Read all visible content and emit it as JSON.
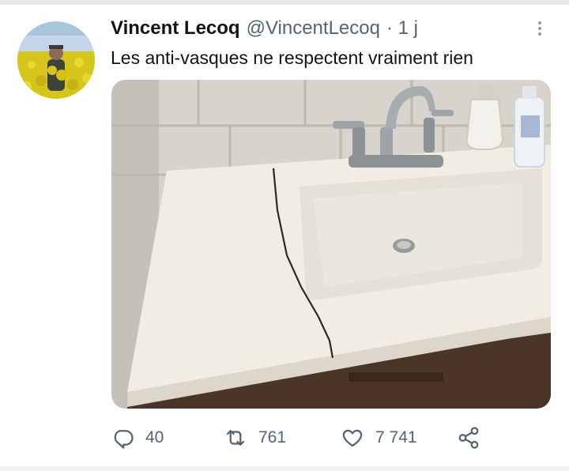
{
  "tweet": {
    "author_name": "Vincent Lecoq",
    "author_handle": "@VincentLecoq",
    "timestamp": "· 1 j",
    "text": "Les anti-vasques ne respectent vraiment rien",
    "more_icon": "more-vertical-icon",
    "avatar_alt": "avatar"
  },
  "actions": {
    "reply": {
      "icon": "reply-icon",
      "count": "40"
    },
    "retweet": {
      "icon": "retweet-icon",
      "count": "761"
    },
    "like": {
      "icon": "heart-icon",
      "count": "7 741"
    },
    "share": {
      "icon": "share-icon"
    }
  },
  "colors": {
    "text_primary": "#0f1419",
    "text_secondary": "#536471"
  }
}
